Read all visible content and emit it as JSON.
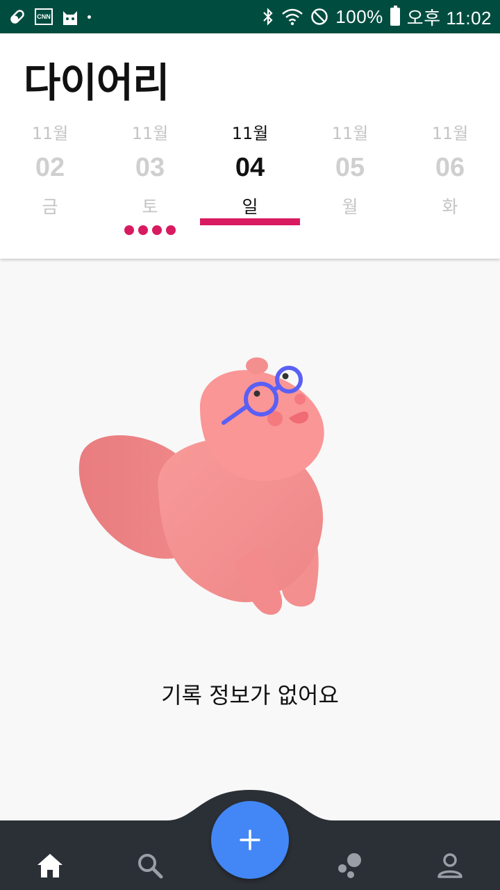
{
  "status_bar": {
    "battery_text": "100%",
    "time": "오후 11:02",
    "left_icons": [
      "pill-icon",
      "cnn-icon",
      "cat-app-icon",
      "dot-icon"
    ],
    "right_icons": [
      "bluetooth-icon",
      "wifi-icon",
      "do-not-disturb-icon",
      "battery-icon"
    ],
    "background": "#004d40"
  },
  "header": {
    "title": "다이어리"
  },
  "date_selector": {
    "selected_index": 2,
    "accent_color": "#d81b60",
    "dates": [
      {
        "month": "11월",
        "day": "02",
        "weekday": "금",
        "record_dots": 0
      },
      {
        "month": "11월",
        "day": "03",
        "weekday": "토",
        "record_dots": 4
      },
      {
        "month": "11월",
        "day": "04",
        "weekday": "일",
        "record_dots": 0
      },
      {
        "month": "11월",
        "day": "05",
        "weekday": "월",
        "record_dots": 0
      },
      {
        "month": "11월",
        "day": "06",
        "weekday": "화",
        "record_dots": 0
      }
    ]
  },
  "main": {
    "illustration": "squirrel-with-glasses-illustration",
    "empty_message": "기록 정보가 없어요"
  },
  "bottom_nav": {
    "background": "#2b2f36",
    "fab_color": "#4287f5",
    "items": [
      {
        "icon": "home-icon",
        "active": true
      },
      {
        "icon": "search-icon",
        "active": false
      },
      {
        "icon": "add-icon",
        "active": false
      },
      {
        "icon": "bubbles-icon",
        "active": false
      },
      {
        "icon": "profile-icon",
        "active": false
      }
    ]
  }
}
